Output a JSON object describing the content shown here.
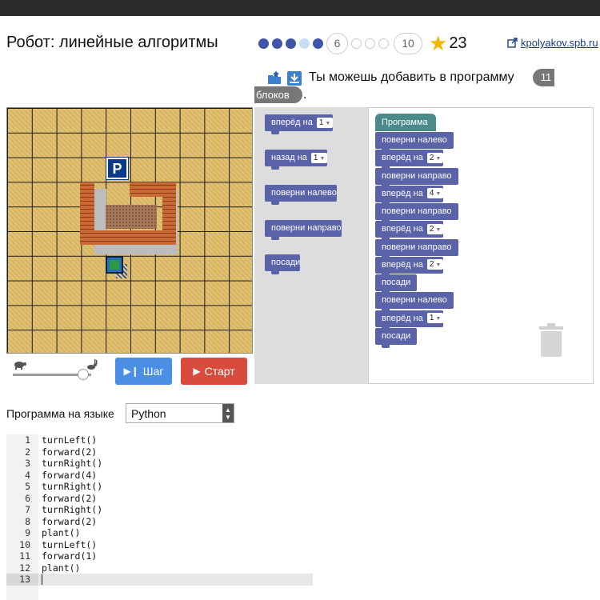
{
  "header": {
    "title": "Робот: линейные алгоритмы",
    "progress": {
      "dots": [
        "done",
        "done",
        "done",
        "partial",
        "done",
        "num",
        "empty",
        "empty",
        "empty",
        "num"
      ],
      "current_label": "6",
      "total_label": "10"
    },
    "score": "23",
    "site_link": "kpolyakov.spb.ru"
  },
  "hint": {
    "text": "Ты можешь добавить в программу",
    "count": "11",
    "unit": "блоков",
    "end": "."
  },
  "controls": {
    "step_label": "Шаг",
    "start_label": "Старт",
    "speed_fraction": 0.9
  },
  "toolbox": {
    "blocks": [
      {
        "label": "вперёд на",
        "value": "1"
      },
      {
        "label": "назад на",
        "value": "1"
      },
      {
        "label": "поверни налево",
        "value": null
      },
      {
        "label": "поверни направо",
        "value": null
      },
      {
        "label": "посади",
        "value": null
      }
    ]
  },
  "program": {
    "hat_label": "Программа",
    "blocks": [
      {
        "label": "поверни налево",
        "value": null
      },
      {
        "label": "вперёд на",
        "value": "2"
      },
      {
        "label": "поверни направо",
        "value": null
      },
      {
        "label": "вперёд на",
        "value": "4"
      },
      {
        "label": "поверни направо",
        "value": null
      },
      {
        "label": "вперёд на",
        "value": "2"
      },
      {
        "label": "поверни направо",
        "value": null
      },
      {
        "label": "вперёд на",
        "value": "2"
      },
      {
        "label": "посади",
        "value": null
      },
      {
        "label": "поверни налево",
        "value": null
      },
      {
        "label": "вперёд на",
        "value": "1"
      },
      {
        "label": "посади",
        "value": null
      }
    ]
  },
  "language": {
    "label": "Программа на языке",
    "selected": "Python"
  },
  "editor": {
    "lines": [
      {
        "n": "1",
        "code": "turnLeft()"
      },
      {
        "n": "2",
        "code": "forward(2)"
      },
      {
        "n": "3",
        "code": "turnRight()"
      },
      {
        "n": "4",
        "code": "forward(4)"
      },
      {
        "n": "5",
        "code": "turnRight()"
      },
      {
        "n": "6",
        "code": "forward(2)"
      },
      {
        "n": "7",
        "code": "turnRight()"
      },
      {
        "n": "8",
        "code": "forward(2)"
      },
      {
        "n": "9",
        "code": "plant()"
      },
      {
        "n": "10",
        "code": "turnLeft()"
      },
      {
        "n": "11",
        "code": "forward(1)"
      },
      {
        "n": "12",
        "code": "plant()"
      },
      {
        "n": "13",
        "code": ""
      }
    ]
  },
  "field": {
    "parking_label": "P"
  }
}
